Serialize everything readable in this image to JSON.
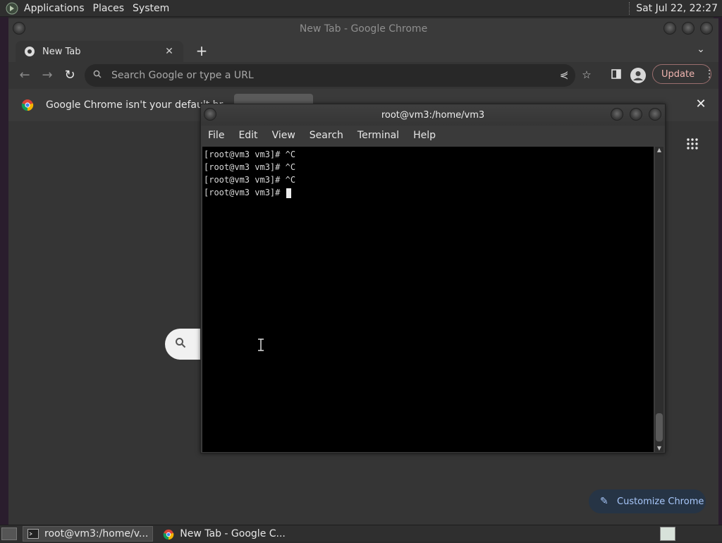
{
  "top_panel": {
    "menus": [
      "Applications",
      "Places",
      "System"
    ],
    "clock": "Sat Jul 22, 22:27"
  },
  "chrome": {
    "window_title": "New Tab - Google Chrome",
    "tab": {
      "title": "New Tab"
    },
    "omnibox": {
      "placeholder": "Search Google or type a URL"
    },
    "update_label": "Update",
    "infobar": {
      "message": "Google Chrome isn't your default br"
    },
    "customize_label": "Customize Chrome"
  },
  "terminal": {
    "title": "root@vm3:/home/vm3",
    "menus": [
      "File",
      "Edit",
      "View",
      "Search",
      "Terminal",
      "Help"
    ],
    "lines": [
      "[root@vm3 vm3]# ^C",
      "[root@vm3 vm3]# ^C",
      "[root@vm3 vm3]# ^C",
      "[root@vm3 vm3]# "
    ]
  },
  "taskbar": {
    "tasks": [
      {
        "label": "root@vm3:/home/v...",
        "icon": "terminal-icon"
      },
      {
        "label": "New Tab - Google C...",
        "icon": "chrome-icon"
      }
    ]
  },
  "colors": {
    "accent_update": "#f0b5b0",
    "customize_text": "#a8c7fa",
    "terminal_bg": "#000000"
  }
}
